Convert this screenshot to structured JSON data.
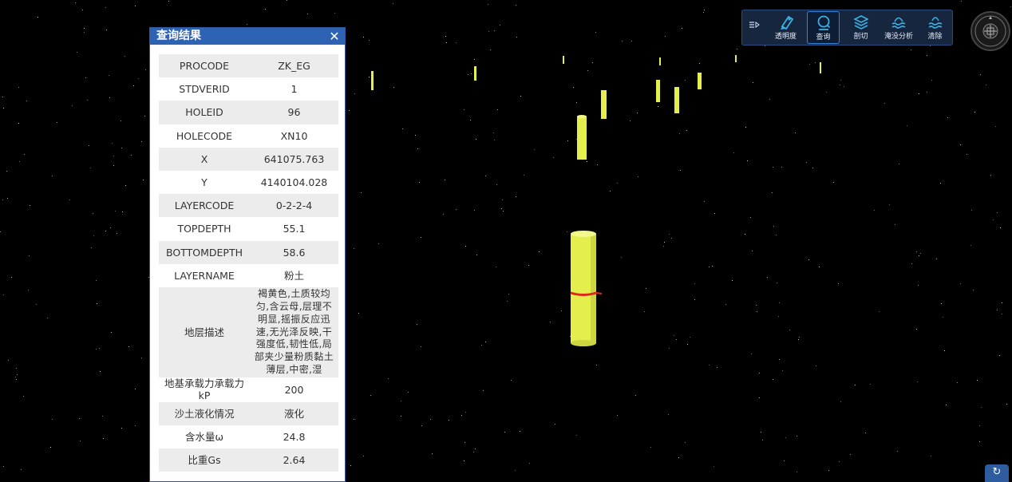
{
  "panel": {
    "title": "查询结果",
    "close_symbol": "✕",
    "rows": [
      {
        "key": "PROCODE",
        "value": "ZK_EG"
      },
      {
        "key": "STDVERID",
        "value": "1"
      },
      {
        "key": "HOLEID",
        "value": "96"
      },
      {
        "key": "HOLECODE",
        "value": "XN10"
      },
      {
        "key": "X",
        "value": "641075.763"
      },
      {
        "key": "Y",
        "value": "4140104.028"
      },
      {
        "key": "LAYERCODE",
        "value": "0-2-2-4"
      },
      {
        "key": "TOPDEPTH",
        "value": "55.1"
      },
      {
        "key": "BOTTOMDEPTH",
        "value": "58.6"
      },
      {
        "key": "LAYERNAME",
        "value": "粉土"
      },
      {
        "key": "地层描述",
        "value": "褐黄色,土质较均匀,含云母,层理不明显,摇振反应迅速,无光泽反映,干强度低,韧性低,局部夹少量粉质黏土薄层,中密,湿"
      },
      {
        "key": "地基承载力承载力kP",
        "value": "200"
      },
      {
        "key": "沙土液化情况",
        "value": "液化"
      },
      {
        "key": "含水量ω",
        "value": "24.8"
      },
      {
        "key": "比重Gs",
        "value": "2.64"
      }
    ]
  },
  "toolbar": {
    "collapse_symbol": "≡▷",
    "items": [
      {
        "label": "透明度",
        "icon": "transparency-icon"
      },
      {
        "label": "查询",
        "icon": "query-icon",
        "active": true
      },
      {
        "label": "剖切",
        "icon": "section-icon"
      },
      {
        "label": "淹没分析",
        "icon": "flood-analysis-icon"
      },
      {
        "label": "清除",
        "icon": "clear-icon"
      }
    ]
  },
  "compass": {
    "icon": "compass-icon"
  },
  "reset": {
    "icon": "reset-view-icon",
    "symbol": "↻"
  },
  "colors": {
    "background": "#000000",
    "borehole": "#e4ee4d",
    "highlight_ring": "#e0241b",
    "panel_header": "#2e62b3",
    "toolbar_bg": "#17263f",
    "toolbar_icon": "#3ab0e2"
  }
}
